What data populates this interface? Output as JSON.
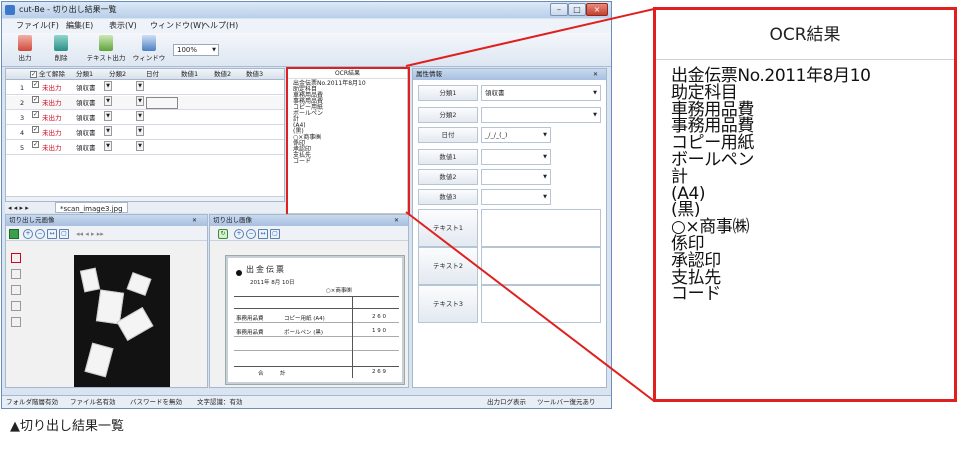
{
  "window": {
    "title": "cut-Be - 切り出し結果一覧",
    "controls": [
      "–",
      "□",
      "×"
    ]
  },
  "menu": [
    "ファイル(F)",
    "編集(E)",
    "表示(V)",
    "ウィンドウ(W)",
    "ヘルプ(H)"
  ],
  "toolbar": {
    "buttons": [
      {
        "label": "出力",
        "icon": "export-icon"
      },
      {
        "label": "削除",
        "icon": "trash-icon"
      },
      {
        "label": "テキスト出力",
        "icon": "text-export-icon"
      },
      {
        "label": "ウィンドウ",
        "icon": "window-icon"
      }
    ],
    "zoom": "100%"
  },
  "grid": {
    "headers": [
      "全て解除",
      "分類1",
      "分類2",
      "日付",
      "数値1",
      "数値2",
      "数値3"
    ],
    "rows": [
      {
        "no": "1",
        "status": "未出力",
        "cat1": "領収書"
      },
      {
        "no": "2",
        "status": "未出力",
        "cat1": "領収書"
      },
      {
        "no": "3",
        "status": "未出力",
        "cat1": "領収書"
      },
      {
        "no": "4",
        "status": "未出力",
        "cat1": "領収書"
      },
      {
        "no": "5",
        "status": "未出力",
        "cat1": "領収書"
      }
    ],
    "sheet_tab": "*scan_image3.jpg"
  },
  "ocr_preview": {
    "title": "OCR結果",
    "lines": [
      "出金伝票No.2011年8月10",
      "助定科目",
      "車務用品費",
      "事務用品費",
      "コピー用紙",
      "ボールペン",
      "計",
      "(A4)",
      "(黒)",
      "○×商事㈱",
      "係印",
      "承認印",
      "支払先",
      "コード"
    ]
  },
  "properties": {
    "title": "属性情報",
    "fields": [
      {
        "label": "分類1",
        "value": "領収書"
      },
      {
        "label": "分類2",
        "value": ""
      },
      {
        "label": "日付",
        "value": "_/_/_(_)"
      },
      {
        "label": "数値1",
        "value": ""
      },
      {
        "label": "数値2",
        "value": ""
      },
      {
        "label": "数値3",
        "value": ""
      }
    ],
    "text_fields": [
      "テキスト1",
      "テキスト2",
      "テキスト3"
    ]
  },
  "left_panel": {
    "title": "切り出し元画像"
  },
  "right_panel": {
    "title": "切り出し画像",
    "slip": {
      "heading": "出金伝票",
      "date": "2011年 8月 10日",
      "payee": "○×商事㈱",
      "row1_account": "事務用品費",
      "row1_desc": "コピー用紙 (A4)",
      "row1_amount": "2 6 0",
      "row2_account": "事務用品費",
      "row2_desc": "ボールペン (黒)",
      "row2_amount": "1 9 0",
      "total_label": "合　　　計",
      "total_amount": "2 6 9"
    }
  },
  "statusbar": {
    "items": [
      "フォルダ階層有効",
      "ファイル名有効",
      "バスワードを無効",
      "文字認識：有効"
    ],
    "right": [
      "出力ログ表示",
      "ツールバー復元あり"
    ]
  },
  "zoom_callout": {
    "title": "OCR結果",
    "lines": [
      "出金伝票No.2011年8月10",
      "助定科目",
      "車務用品費",
      "事務用品費",
      "コピー用紙",
      "ボールペン",
      "計",
      "(A4)",
      "(黒)",
      "○×商事㈱",
      "係印",
      "承認印",
      "支払先",
      "コード"
    ]
  },
  "caption": "▲切り出し結果一覧"
}
